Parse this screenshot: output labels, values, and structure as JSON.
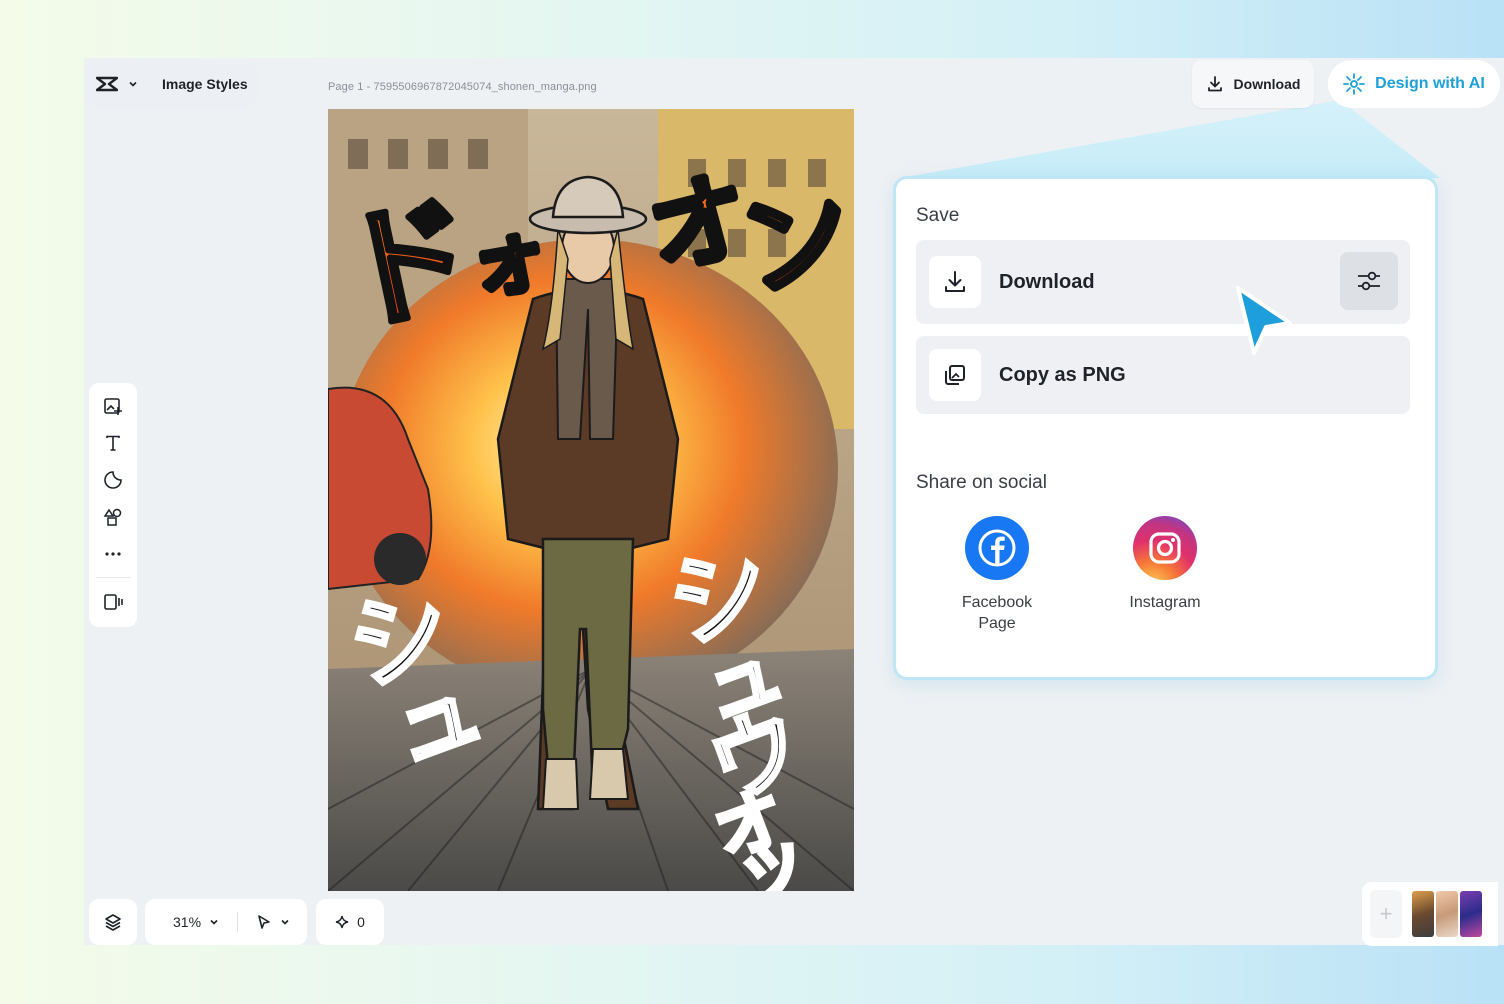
{
  "header": {
    "brand_label": "Image Styles",
    "page_info": "Page 1 -  7595506967872045074_shonen_manga.png",
    "download_label": "Download",
    "ai_label": "Design with AI"
  },
  "toolbar": {
    "tools": [
      "add-image-icon",
      "text-icon",
      "sticker-icon",
      "shapes-icon",
      "more-icon",
      "panel-toggle-icon"
    ]
  },
  "bottom_bar": {
    "zoom": "31%",
    "ai_credits": "0"
  },
  "canvas": {
    "description_text": "",
    "sfx_top": "ドォオン",
    "sfx_bottom_left": "シュ",
    "sfx_bottom_right": "シュウォッ"
  },
  "share_panel": {
    "save_title": "Save",
    "download_label": "Download",
    "copy_label": "Copy as PNG",
    "social_title": "Share on social",
    "socials": [
      {
        "name": "Facebook\nPage",
        "line1": "Facebook",
        "line2": "Page",
        "color": "#1877f2"
      },
      {
        "name": "Instagram",
        "line1": "Instagram",
        "line2": "",
        "color": "#e1306c"
      }
    ]
  },
  "colors": {
    "accent": "#1ea0d8",
    "panel_border": "#bfe6f5"
  }
}
